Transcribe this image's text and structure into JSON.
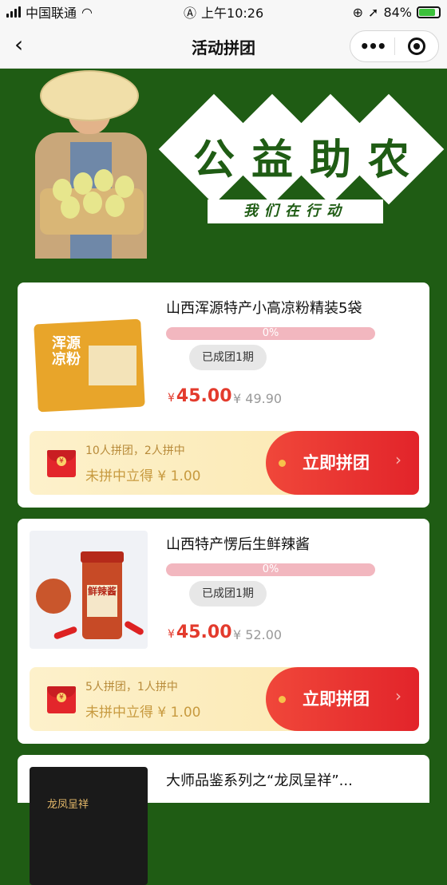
{
  "status": {
    "carrier": "中国联通",
    "time": "上午10:26",
    "battery": "84%"
  },
  "nav": {
    "back": "‹",
    "title": "活动拼团",
    "more": "•••"
  },
  "banner": {
    "chars": [
      "公",
      "益",
      "助",
      "农"
    ],
    "slogan": "我们在行动"
  },
  "products": [
    {
      "name": "山西浑源特产小高凉粉精装5袋",
      "progress": "0%",
      "groups": "已成团1期",
      "currency": "¥",
      "price": "45.00",
      "original": "¥ 49.90",
      "rule": "10人拼团，2人拼中",
      "reward": "未拼中立得 ¥ 1.00",
      "join": "立即拼团",
      "arrow": "›",
      "thumb_text": "浑源凉粉"
    },
    {
      "name": "山西特产愣后生鲜辣酱",
      "progress": "0%",
      "groups": "已成团1期",
      "currency": "¥",
      "price": "45.00",
      "original": "¥ 52.00",
      "rule": "5人拼团，1人拼中",
      "reward": "未拼中立得 ¥ 1.00",
      "join": "立即拼团",
      "arrow": "›",
      "thumb_text": "鲜辣酱"
    },
    {
      "name": "大师品鉴系列之“龙凤呈祥”...",
      "thumb_text": "龙凤呈祥"
    }
  ],
  "colors": {
    "green": "#1f5c14",
    "red": "#e33b2d"
  }
}
